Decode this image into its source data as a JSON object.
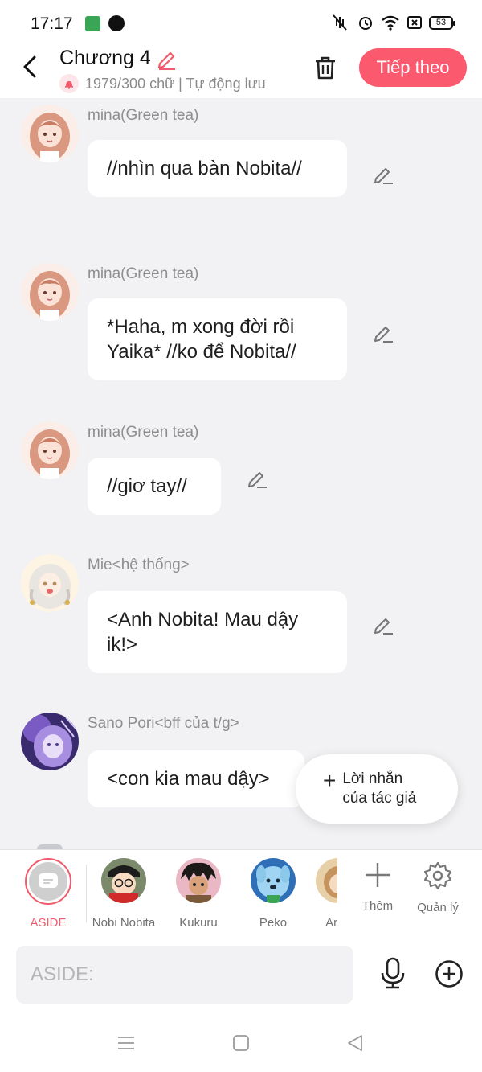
{
  "status_bar": {
    "time": "17:17",
    "battery": "53"
  },
  "header": {
    "title": "Chương 4",
    "subtitle": "1979/300 chữ | Tự động lưu",
    "next_label": "Tiếp theo"
  },
  "messages": [
    {
      "sender": "mina(Green tea)",
      "text": "//nhìn qua bàn Nobita//"
    },
    {
      "sender": "mina(Green tea)",
      "text": "*Haha, m xong đời rồi Yaika* //ko để Nobita//"
    },
    {
      "sender": "mina(Green tea)",
      "text": "//giơ tay//"
    },
    {
      "sender": "Mie<hệ thống>",
      "text": "<Anh Nobita! Mau dậy ik!>"
    },
    {
      "sender": "Sano Pori<bff của t/g>",
      "text": "<con kia mau dậy>"
    }
  ],
  "author_note": {
    "label": "Lời nhắn của tác giả"
  },
  "characters": [
    {
      "name": "ASIDE"
    },
    {
      "name": "Nobi Nobita"
    },
    {
      "name": "Kukuru"
    },
    {
      "name": "Peko"
    },
    {
      "name": "Aron"
    }
  ],
  "tools": {
    "add_label": "Thêm",
    "manage_label": "Quản lý"
  },
  "input": {
    "placeholder": "ASIDE:"
  },
  "colors": {
    "accent": "#fb5a6e",
    "background": "#f2f2f4"
  }
}
